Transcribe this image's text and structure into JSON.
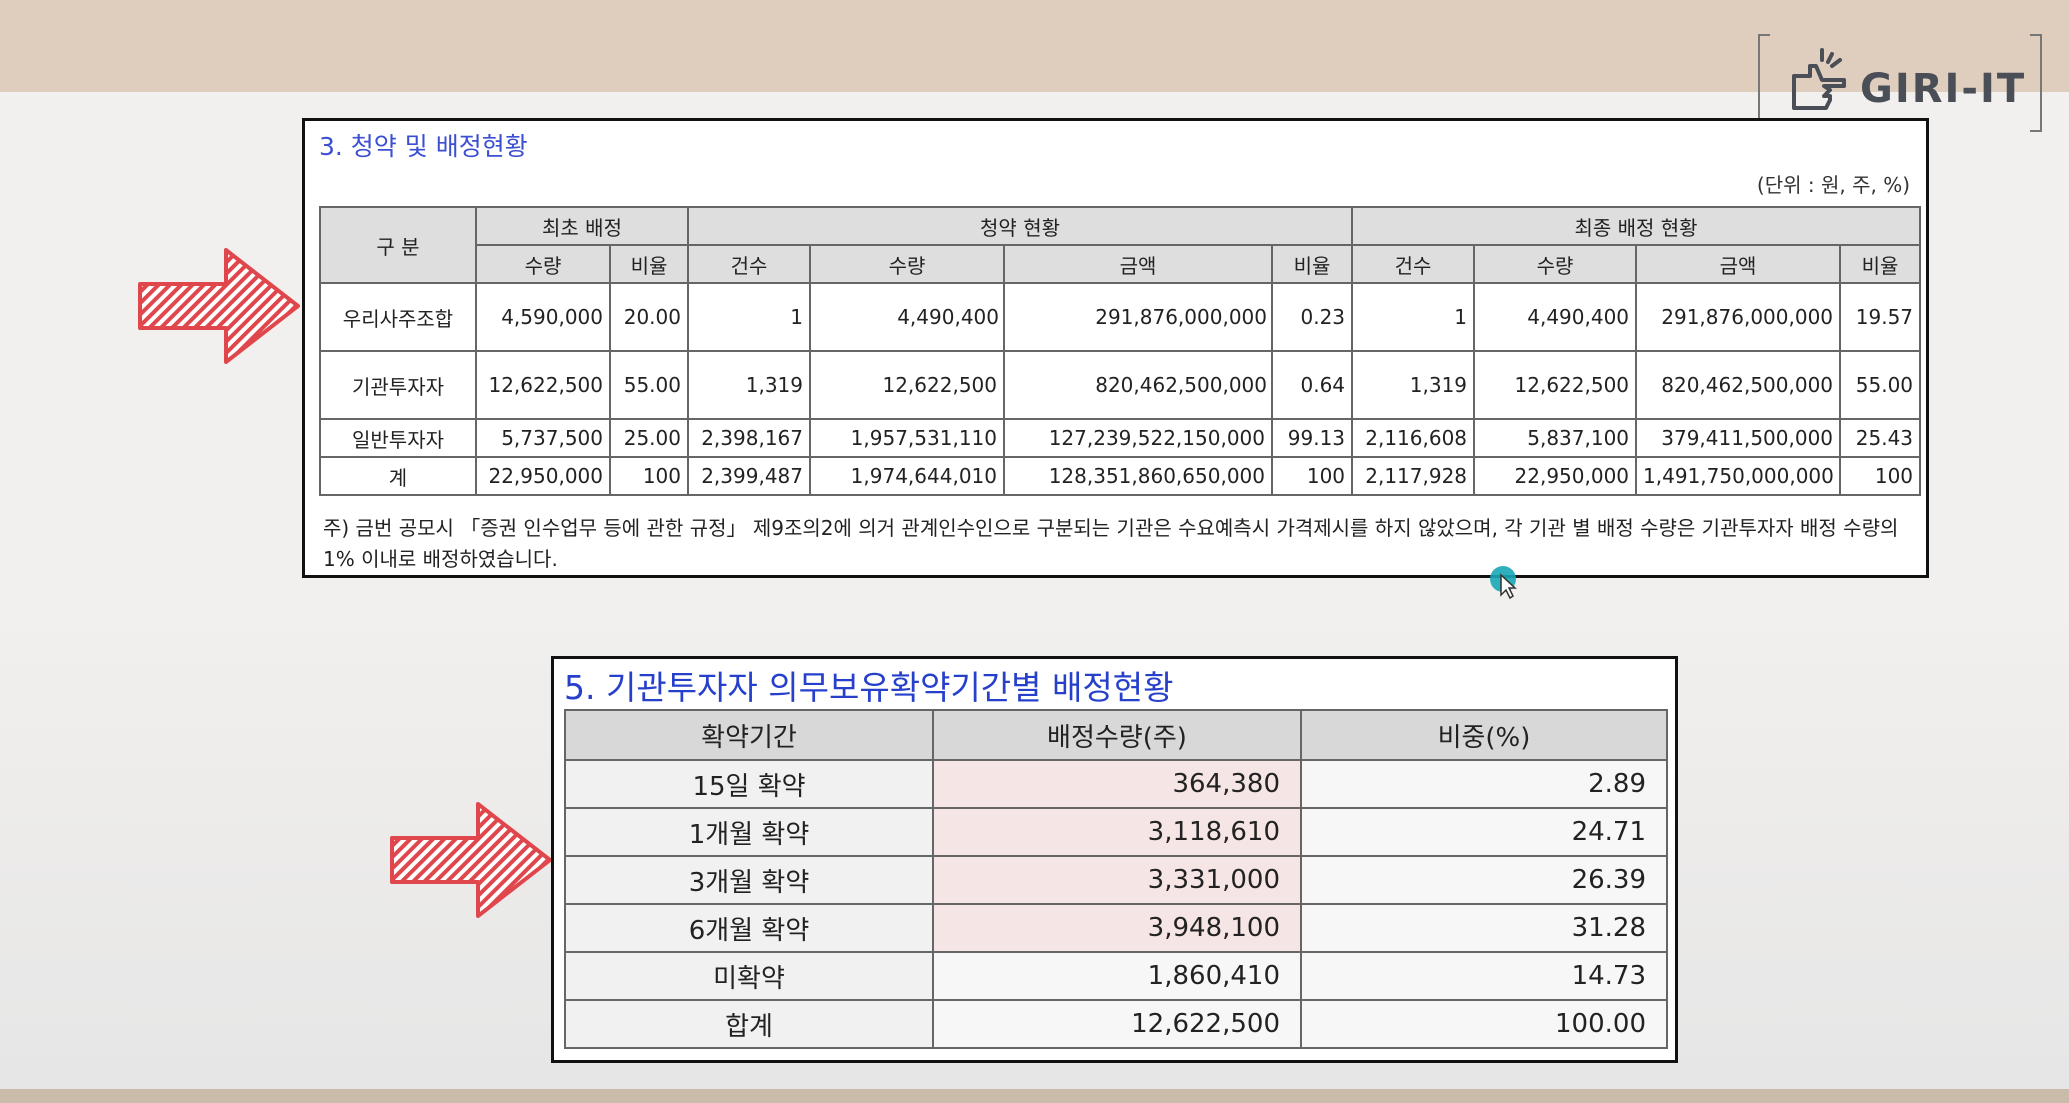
{
  "logo": {
    "text": "GIRI-IT"
  },
  "section3": {
    "title": "3. 청약 및 배정현황",
    "unit": "(단위 : 원, 주, %)",
    "group_headers": {
      "category": "구 분",
      "initial": "최초 배정",
      "subscription": "청약 현황",
      "final": "최종 배정 현황"
    },
    "sub_headers": {
      "qty": "수량",
      "ratio": "비율",
      "count": "건수",
      "amount": "금액"
    },
    "rows": [
      [
        "우리사주조합",
        "4,590,000",
        "20.00",
        "1",
        "4,490,400",
        "291,876,000,000",
        "0.23",
        "1",
        "4,490,400",
        "291,876,000,000",
        "19.57"
      ],
      [
        "기관투자자",
        "12,622,500",
        "55.00",
        "1,319",
        "12,622,500",
        "820,462,500,000",
        "0.64",
        "1,319",
        "12,622,500",
        "820,462,500,000",
        "55.00"
      ],
      [
        "일반투자자",
        "5,737,500",
        "25.00",
        "2,398,167",
        "1,957,531,110",
        "127,239,522,150,000",
        "99.13",
        "2,116,608",
        "5,837,100",
        "379,411,500,000",
        "25.43"
      ],
      [
        "계",
        "22,950,000",
        "100",
        "2,399,487",
        "1,974,644,010",
        "128,351,860,650,000",
        "100",
        "2,117,928",
        "22,950,000",
        "1,491,750,000,000",
        "100"
      ]
    ],
    "note": "주) 금번 공모시 「증권 인수업무 등에 관한 규정」 제9조의2에 의거 관계인수인으로 구분되는 기관은 수요예측시 가격제시를 하지 않았으며, 각 기관 별 배정 수량은 기관투자자 배정 수량의 1% 이내로 배정하였습니다."
  },
  "section5": {
    "title": "5. 기관투자자 의무보유확약기간별 배정현황",
    "headers": [
      "확약기간",
      "배정수량(주)",
      "비중(%)"
    ],
    "rows": [
      [
        "15일 확약",
        "364,380",
        "2.89"
      ],
      [
        "1개월 확약",
        "3,118,610",
        "24.71"
      ],
      [
        "3개월 확약",
        "3,331,000",
        "26.39"
      ],
      [
        "6개월 확약",
        "3,948,100",
        "31.28"
      ],
      [
        "미확약",
        "1,860,410",
        "14.73"
      ],
      [
        "합계",
        "12,622,500",
        "100.00"
      ]
    ]
  },
  "colors": {
    "title_blue": "#3b4fd0",
    "arrow_red": "#e0474c",
    "cursor_teal": "#1aa7b5"
  }
}
